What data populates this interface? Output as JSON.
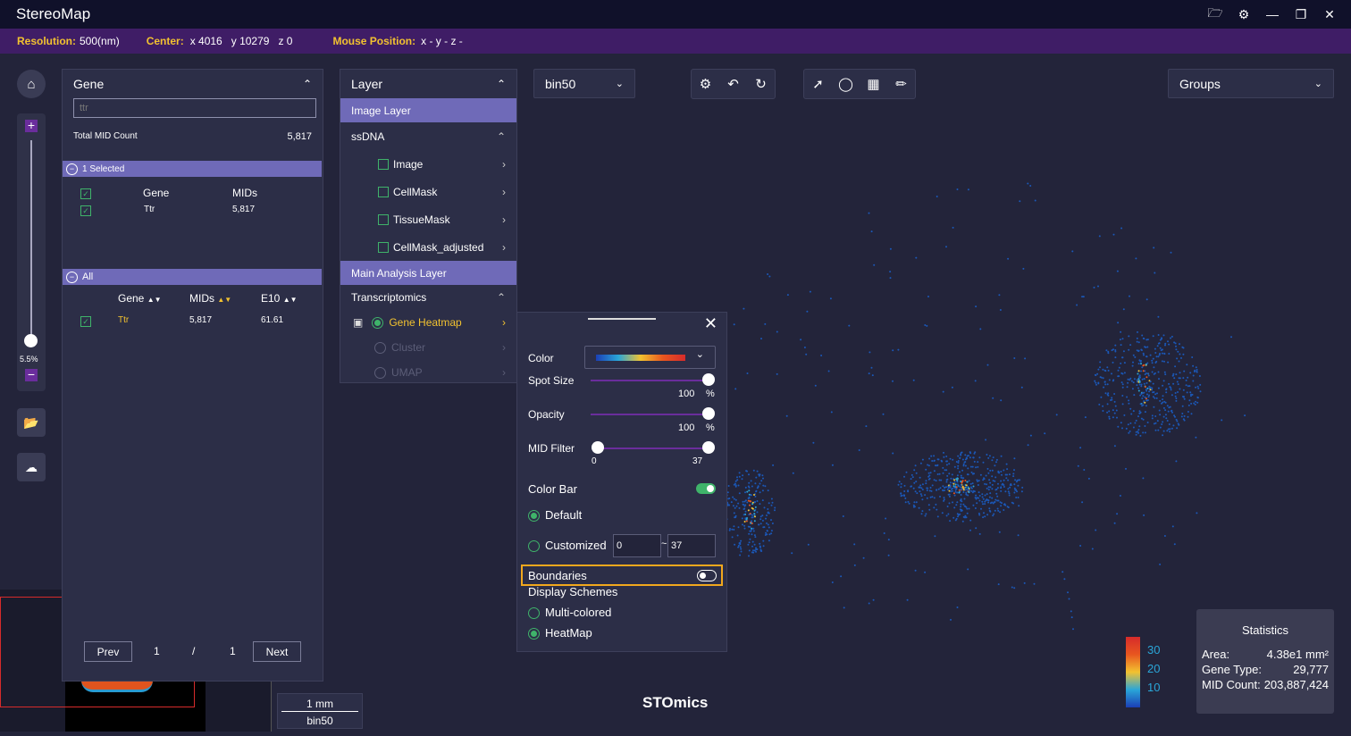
{
  "app": {
    "title": "StereoMap"
  },
  "status": {
    "resolution_label": "Resolution:",
    "resolution_value": "500(nm)",
    "center_label": "Center:",
    "center_x": "x 4016",
    "center_y": "y 10279",
    "center_z": "z 0",
    "mouse_label": "Mouse Position:",
    "mouse_value": "x -  y -  z -"
  },
  "zoom": {
    "level": "5.5%",
    "plus": "+",
    "minus": "−"
  },
  "gene_panel": {
    "title": "Gene",
    "search_value": "ttr",
    "total_label": "Total MID Count",
    "total_value": "5,817",
    "selected_label": "1 Selected",
    "selected_headers": [
      "Gene",
      "MIDs"
    ],
    "selected_rows": [
      {
        "gene": "Ttr",
        "mids": "5,817"
      }
    ],
    "all_label": "All",
    "all_headers": [
      "Gene",
      "MIDs",
      "E10"
    ],
    "all_rows": [
      {
        "gene": "Ttr",
        "mids": "5,817",
        "e10": "61.61"
      }
    ],
    "prev": "Prev",
    "page": "1",
    "sep": "/",
    "pages": "1",
    "next": "Next"
  },
  "layer_panel": {
    "title": "Layer",
    "image_layer": "Image Layer",
    "ssdna": "ssDNA",
    "image_items": [
      "Image",
      "CellMask",
      "TissueMask",
      "CellMask_adjusted"
    ],
    "main_layer": "Main Analysis Layer",
    "transcriptomics": "Transcriptomics",
    "heatmap": "Gene Heatmap",
    "cluster": "Cluster",
    "umap": "UMAP"
  },
  "bin_select": {
    "value": "bin50"
  },
  "groups_select": {
    "value": "Groups"
  },
  "heatmap_popup": {
    "color_label": "Color",
    "spot_label": "Spot Size",
    "spot_value": "100",
    "spot_unit": "%",
    "opacity_label": "Opacity",
    "opacity_value": "100",
    "opacity_unit": "%",
    "mid_label": "MID Filter",
    "mid_min": "0",
    "mid_max": "37",
    "colorbar_label": "Color Bar",
    "default_label": "Default",
    "custom_label": "Customized",
    "custom_from": "0",
    "custom_tilde": "~",
    "custom_to": "37",
    "boundaries_label": "Boundaries",
    "schemes_label": "Display Schemes",
    "multi_label": "Multi-colored",
    "heatmap_label": "HeatMap"
  },
  "scale": {
    "distance": "1 mm",
    "bin": "bin50"
  },
  "brand": "STOmics",
  "legend": {
    "ticks": [
      "30",
      "20",
      "10"
    ]
  },
  "statistics": {
    "title": "Statistics",
    "area_label": "Area:",
    "area_value": "4.38e1 mm²",
    "type_label": "Gene Type:",
    "type_value": "29,777",
    "mid_label": "MID Count:",
    "mid_value": "203,887,424"
  },
  "colors": {
    "accent": "#f2c230",
    "purple": "#3f1d66",
    "green": "#3fb36a",
    "band": "#6f6ab8"
  }
}
